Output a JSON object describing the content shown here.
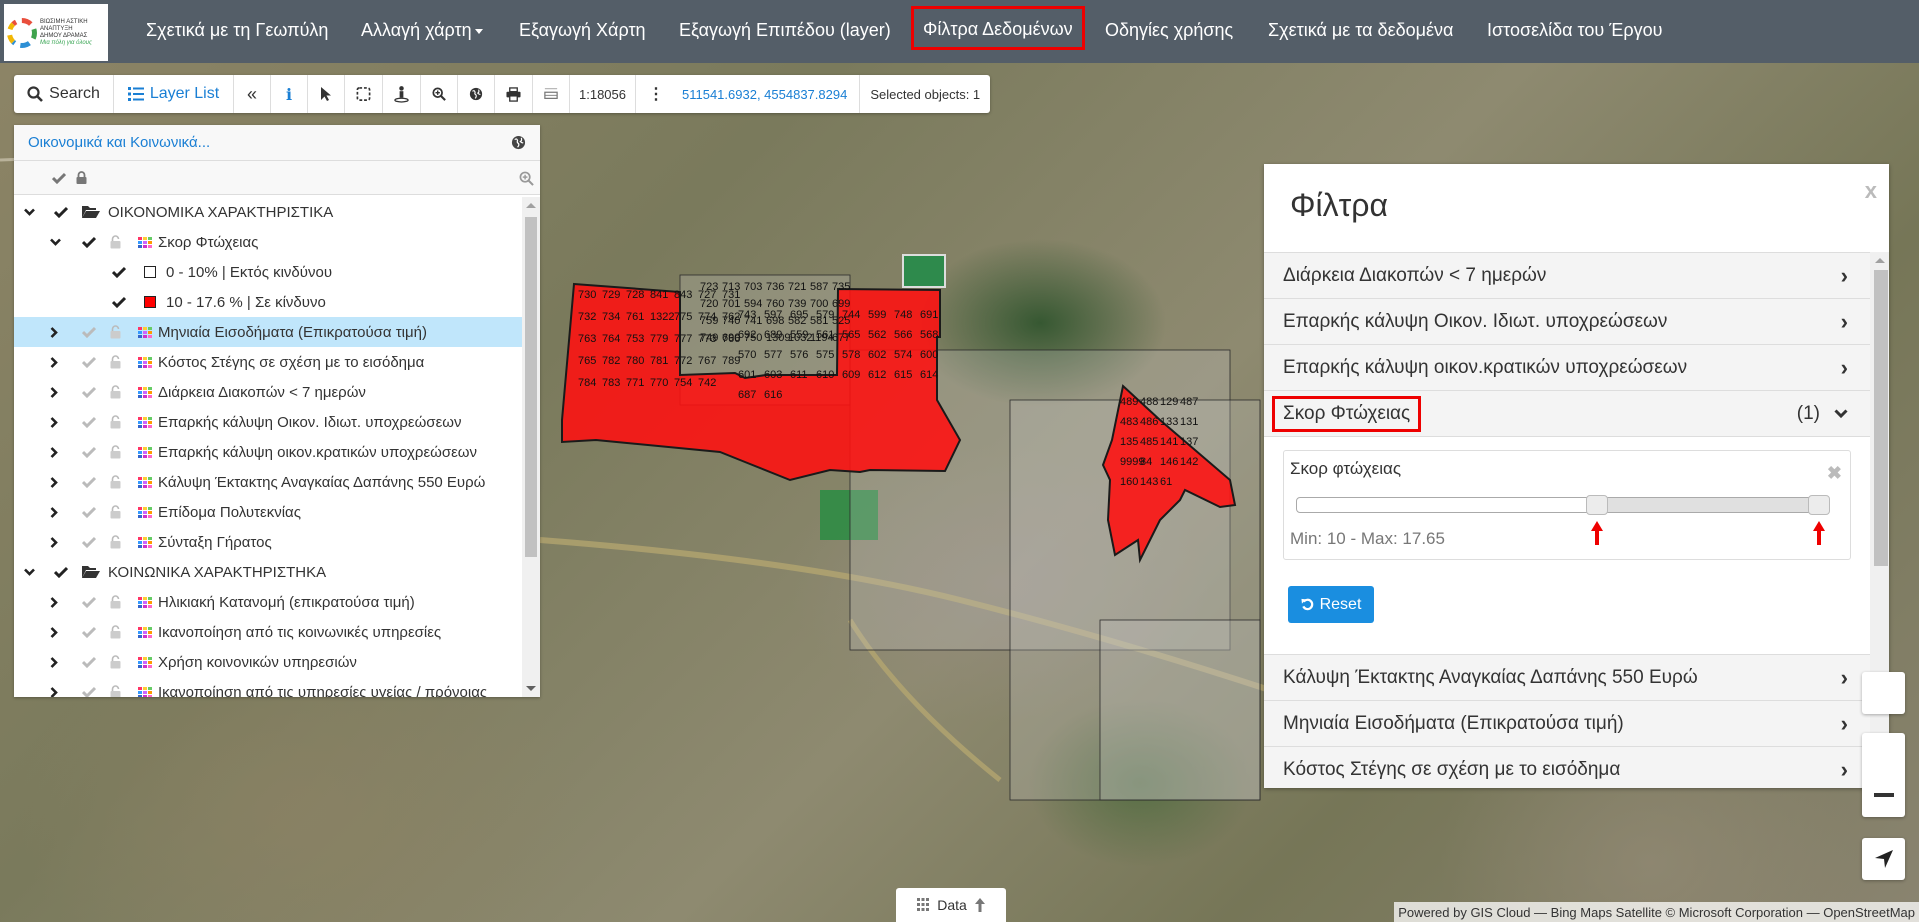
{
  "navbar": {
    "logo": {
      "line1": "ΒΙΩΣΙΜΗ ΑΣΤΙΚΗ ΑΝΑΠΤΥΞΗ",
      "line2": "ΔΗΜΟΥ ΔΡΑΜΑΣ",
      "slogan": "Μια πόλη για όλους"
    },
    "items": [
      {
        "label": "Σχετικά με τη Γεωπύλη"
      },
      {
        "label": "Αλλαγή χάρτη",
        "dropdown": true
      },
      {
        "label": "Εξαγωγή Χάρτη"
      },
      {
        "label": "Εξαγωγή Επιπέδου (layer)"
      },
      {
        "label": "Φίλτρα Δεδομένων",
        "active": true
      },
      {
        "label": "Οδηγίες χρήσης"
      },
      {
        "label": "Σχετικά με τα δεδομένα"
      },
      {
        "label": "Ιστοσελίδα του Έργου"
      }
    ]
  },
  "toolbar": {
    "search_label": "Search",
    "layer_list_label": "Layer List",
    "scale": "1:18056",
    "coordinates": "511541.6932, 4554837.8294",
    "selected_objects": "Selected objects: 1",
    "icons": [
      "search-icon",
      "list-icon",
      "collapse-icon",
      "info-icon",
      "pointer-icon",
      "select-box-icon",
      "street-view-icon",
      "zoom-in-icon",
      "globe-icon",
      "print-icon",
      "measure-icon",
      "more-icon"
    ]
  },
  "layer_panel": {
    "title": "Οικονομικά και Κοινωνικά...",
    "groups": [
      {
        "label": "ΟΙΚΟΝΟΜΙΚΑ ΧΑΡΑΚΤΗΡΙΣΤΙΚΑ",
        "expanded": true,
        "checked": true,
        "layers": [
          {
            "label": "Σκορ Φτώχειας",
            "expanded": true,
            "checked": true,
            "legend": [
              {
                "label": "0 - 10% | Εκτός κινδύνου",
                "color": "#ffffff"
              },
              {
                "label": "10 - 17.6 % | Σε κίνδυνο",
                "color": "#ff0000"
              }
            ]
          },
          {
            "label": "Μηνιαία Εισοδήματα (Επικρατούσα τιμή)",
            "selected": true
          },
          {
            "label": "Κόστος Στέγης σε σχέση με το εισόδημα"
          },
          {
            "label": "Διάρκεια Διακοπών < 7 ημερών"
          },
          {
            "label": "Επαρκής κάλυψη Οικον. Ιδιωτ. υποχρεώσεων"
          },
          {
            "label": "Επαρκής κάλυψη οικον.κρατικών υποχρεώσεων"
          },
          {
            "label": "Κάλυψη Έκτακτης Αναγκαίας Δαπάνης 550 Ευρώ"
          },
          {
            "label": "Επίδομα Πολυτεκνίας"
          },
          {
            "label": "Σύνταξη Γήρατος"
          }
        ]
      },
      {
        "label": "ΚΟΙΝΩΝΙΚΑ ΧΑΡΑΚΤΗΡΙΣΤΗΚΑ",
        "expanded": true,
        "checked": true,
        "layers": [
          {
            "label": "Ηλικιακή Κατανομή (επικρατούσα τιμή)"
          },
          {
            "label": "Ικανοποίηση από τις κοινωνικές υπηρεσίες"
          },
          {
            "label": "Χρήση κοινονικών υπηρεσιών"
          },
          {
            "label": "Ικανοποίηση από τις υπηρεσίες υγείας / πρόνοιας"
          }
        ]
      }
    ]
  },
  "filter_panel": {
    "title": "Φίλτρα",
    "close_label": "x",
    "accordion_before": [
      {
        "label": "Διάρκεια Διακοπών < 7 ημερών"
      },
      {
        "label": "Επαρκής κάλυψη Οικον. Ιδιωτ. υποχρεώσεων"
      },
      {
        "label": "Επαρκής κάλυψη οικον.κρατικών υποχρεώσεων"
      }
    ],
    "open_section": {
      "label": "Σκορ Φτώχειας",
      "count": "(1)",
      "filter": {
        "label": "Σκορ φτώχειας",
        "range_min": 0,
        "range_max": 17.65,
        "selected_min": 10,
        "selected_max": 17.65,
        "minmax_text": "Min: 10 - Max: 17.65"
      },
      "reset_label": "Reset"
    },
    "accordion_after": [
      {
        "label": "Κάλυψη Έκτακτης Αναγκαίας Δαπάνης 550 Ευρώ"
      },
      {
        "label": "Μηνιαία Εισοδήματα (Επικρατούσα τιμή)"
      },
      {
        "label": "Κόστος Στέγης σε σχέση με το εισόδημα"
      }
    ]
  },
  "map": {
    "highlight_color": "#ff0000",
    "parcels_west": [
      "730",
      "729",
      "728",
      "841",
      "843",
      "727",
      "731",
      "732",
      "734",
      "761",
      "1322",
      "775",
      "774",
      "762",
      "763",
      "764",
      "753",
      "779",
      "777",
      "773",
      "766",
      "765",
      "782",
      "780",
      "781",
      "772",
      "767",
      "789",
      "784",
      "783",
      "771",
      "770",
      "754",
      "742",
      "743",
      "597",
      "695",
      "579",
      "744",
      "599",
      "748",
      "691",
      "692",
      "689",
      "559",
      "561",
      "565",
      "562",
      "566",
      "568",
      "570",
      "577",
      "576",
      "575",
      "578",
      "602",
      "574",
      "600",
      "601",
      "603",
      "611",
      "610",
      "609",
      "612",
      "615",
      "614",
      "687",
      "616"
    ],
    "parcels_east": [
      "489",
      "488",
      "129",
      "487",
      "483",
      "486",
      "133",
      "131",
      "135",
      "485",
      "141",
      "137",
      "9999",
      "84",
      "146",
      "142",
      "160",
      "143",
      "61"
    ],
    "parcels_other": [
      "723",
      "713",
      "703",
      "736",
      "721",
      "587",
      "735",
      "720",
      "701",
      "594",
      "760",
      "739",
      "700",
      "699",
      "759",
      "740",
      "741",
      "698",
      "582",
      "581",
      "525",
      "749",
      "690",
      "750",
      "1309",
      "1032",
      "1194",
      "677"
    ]
  },
  "data_button_label": "Data",
  "attribution": "Powered by GIS Cloud — Bing Maps Satellite © Microsoft Corporation — OpenStreetMap"
}
